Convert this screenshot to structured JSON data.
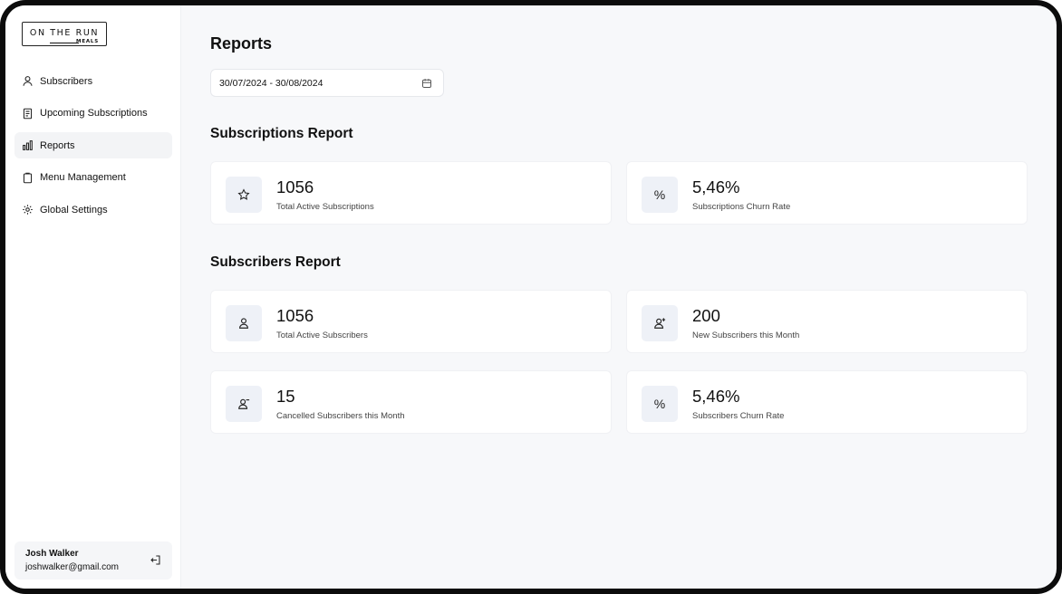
{
  "brand": {
    "logo_main": "ON THE RUN",
    "logo_sub": "MEALS"
  },
  "sidebar": {
    "items": [
      {
        "label": "Subscribers",
        "icon": "user-icon"
      },
      {
        "label": "Upcoming Subscriptions",
        "icon": "receipt-icon"
      },
      {
        "label": "Reports",
        "icon": "bar-chart-icon",
        "active": true
      },
      {
        "label": "Menu Management",
        "icon": "clipboard-icon"
      },
      {
        "label": "Global Settings",
        "icon": "gear-icon"
      }
    ],
    "user": {
      "name": "Josh Walker",
      "email": "joshwalker@gmail.com"
    }
  },
  "page": {
    "title": "Reports",
    "date_range": "30/07/2024 - 30/08/2024"
  },
  "subscriptions_report": {
    "title": "Subscriptions Report",
    "cards": [
      {
        "value": "1056",
        "label": "Total Active Subscriptions",
        "icon": "star-icon"
      },
      {
        "value": "5,46%",
        "label": "Subscriptions Churn Rate",
        "icon": "percent-icon",
        "glyph": "%"
      }
    ]
  },
  "subscribers_report": {
    "title": "Subscribers Report",
    "cards": [
      {
        "value": "1056",
        "label": "Total Active Subscribers",
        "icon": "user-icon"
      },
      {
        "value": "200",
        "label": "New Subscribers this Month",
        "icon": "user-plus-icon"
      },
      {
        "value": "15",
        "label": "Cancelled Subscribers this Month",
        "icon": "user-minus-icon"
      },
      {
        "value": "5,46%",
        "label": "Subscribers Churn Rate",
        "icon": "percent-icon",
        "glyph": "%"
      }
    ]
  },
  "colors": {
    "background": "#f7f8fa",
    "card": "#ffffff",
    "icon_tile": "#eef1f7",
    "active_nav": "#f3f4f6"
  }
}
